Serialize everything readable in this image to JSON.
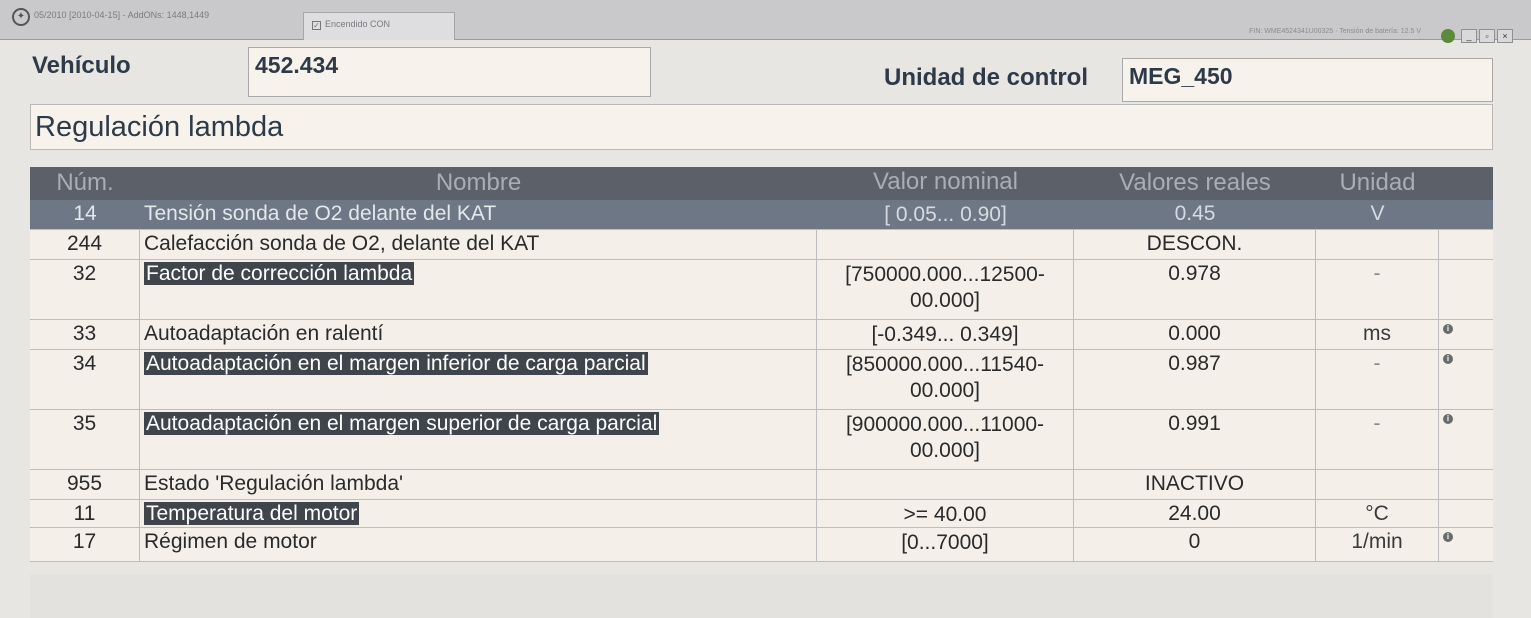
{
  "titlebar": {
    "app_title": "05/2010 [2010-04-15] - AddONs: 1448,1449",
    "tab_label": "Encendido CON",
    "status": "FIN: WME4524341U00325 · Tensión de batería: 12.5 V",
    "min_label": "_",
    "max_label": "▫",
    "close_label": "×"
  },
  "header": {
    "vehicle_label": "Vehículo",
    "vehicle_value": "452.434",
    "ecu_label": "Unidad de control",
    "ecu_value": "MEG_450"
  },
  "section_title": "Regulación lambda",
  "table": {
    "columns": {
      "num": "Núm.",
      "name": "Nombre",
      "nominal": "Valor nominal",
      "actual": "Valores reales",
      "unit": "Unidad"
    },
    "rows": [
      {
        "num": "14",
        "name": "Tensión sonda de O2 delante del KAT",
        "nominal": "[ 0.05... 0.90]",
        "actual": "0.45",
        "unit": "V",
        "highlight": false,
        "info": false
      },
      {
        "num": "244",
        "name": "Calefacción sonda de O2, delante del KAT",
        "nominal": "",
        "actual": "DESCON.",
        "unit": "",
        "highlight": false,
        "info": false
      },
      {
        "num": "32",
        "name": "Factor de corrección lambda",
        "nominal": "[750000.000...12500-00.000]",
        "actual": "0.978",
        "unit": "-",
        "highlight": true,
        "info": false
      },
      {
        "num": "33",
        "name": "Autoadaptación en ralentí",
        "nominal": "[-0.349... 0.349]",
        "actual": "0.000",
        "unit": "ms",
        "highlight": false,
        "info": true
      },
      {
        "num": "34",
        "name": "Autoadaptación en el margen inferior de carga parcial",
        "nominal": "[850000.000...11540-00.000]",
        "actual": "0.987",
        "unit": "-",
        "highlight": true,
        "info": true
      },
      {
        "num": "35",
        "name": "Autoadaptación en el margen superior de carga parcial",
        "nominal": "[900000.000...11000-00.000]",
        "actual": "0.991",
        "unit": "-",
        "highlight": true,
        "info": true
      },
      {
        "num": "955",
        "name": "Estado 'Regulación lambda'",
        "nominal": "",
        "actual": "INACTIVO",
        "unit": "",
        "highlight": false,
        "info": false
      },
      {
        "num": "11",
        "name": "Temperatura del motor",
        "nominal": ">=  40.00",
        "actual": "24.00",
        "unit": "°C",
        "highlight": true,
        "info": false
      },
      {
        "num": "17",
        "name": "Régimen de motor",
        "nominal": "[0...7000]",
        "actual": "0",
        "unit": "1/min",
        "highlight": false,
        "info": true
      }
    ]
  }
}
